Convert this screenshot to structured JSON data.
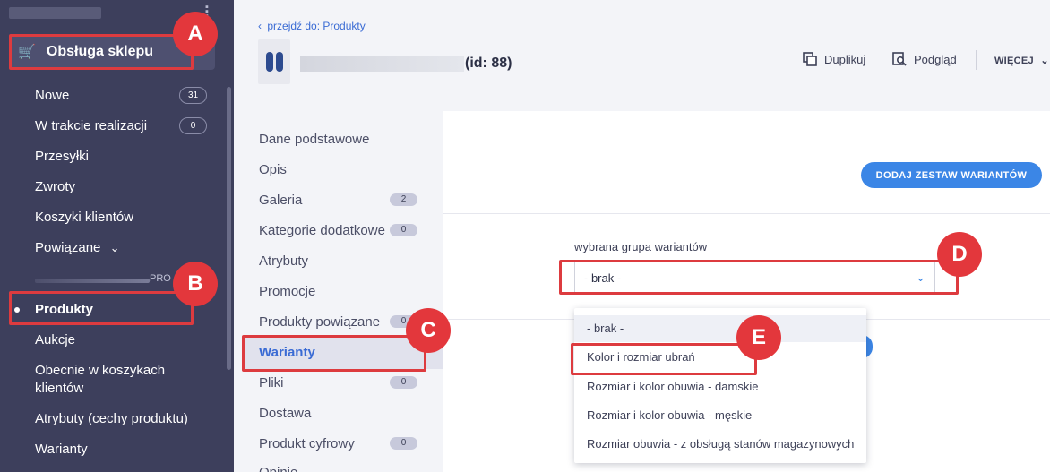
{
  "sidebar": {
    "section_title": "Obsługa sklepu",
    "items": [
      {
        "label": "Nowe",
        "badge": "31"
      },
      {
        "label": "W trakcie realizacji",
        "badge": "0"
      },
      {
        "label": "Przesyłki"
      },
      {
        "label": "Zwroty"
      },
      {
        "label": "Koszyki klientów"
      },
      {
        "label": "Powiązane"
      }
    ],
    "divider_label": "PRO",
    "products_items": [
      {
        "label": "Produkty"
      },
      {
        "label": "Aukcje"
      },
      {
        "label": "Obecnie w koszykach"
      },
      {
        "label": "klientów"
      },
      {
        "label": "Atrybuty (cechy produktu)"
      },
      {
        "label": "Warianty"
      }
    ]
  },
  "header": {
    "back_link": "przejdź do: Produkty",
    "product_id": "(id: 88)",
    "duplicate": "Duplikuj",
    "preview": "Podgląd",
    "more": "WIĘCEJ"
  },
  "tabs": [
    {
      "label": "Dane podstawowe"
    },
    {
      "label": "Opis"
    },
    {
      "label": "Galeria",
      "badge": "2"
    },
    {
      "label": "Kategorie dodatkowe",
      "badge": "0"
    },
    {
      "label": "Atrybuty"
    },
    {
      "label": "Promocje"
    },
    {
      "label": "Produkty powiązane",
      "badge": "0"
    },
    {
      "label": "Warianty"
    },
    {
      "label": "Pliki",
      "badge": "0"
    },
    {
      "label": "Dostawa"
    },
    {
      "label": "Produkt cyfrowy",
      "badge": "0"
    },
    {
      "label": "Opinie"
    }
  ],
  "content": {
    "add_button": "DODAJ ZESTAW WARIANTÓW",
    "field_label": "wybrana grupa wariantów",
    "selected_value": "- brak -",
    "options": [
      "- brak -",
      "Kolor i rozmiar ubrań",
      "Rozmiar i kolor obuwia - damskie",
      "Rozmiar i kolor obuwia - męskie",
      "Rozmiar obuwia - z obsługą stanów magazynowych"
    ]
  },
  "markers": [
    "A",
    "B",
    "C",
    "D",
    "E"
  ],
  "colors": {
    "accent": "#3b86e6",
    "sidebar": "#3d3f5c",
    "highlight": "#dd3b3f"
  }
}
